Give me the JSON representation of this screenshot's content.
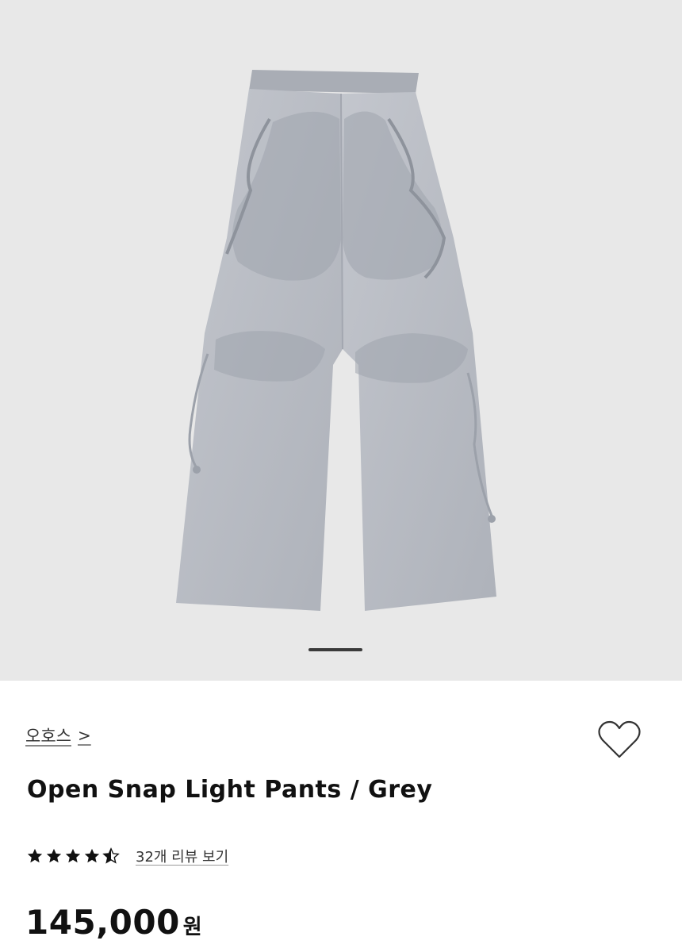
{
  "product": {
    "brand": "오호스",
    "brand_chevron": ">",
    "name": "Open Snap Light Pants / Grey",
    "rating": 4.5,
    "reviews_label": "32개 리뷰 보기",
    "price": "145,000",
    "currency": "원"
  },
  "gallery": {
    "image_subject": "grey-cutout-pants",
    "current_slide": 1
  },
  "icons": {
    "wishlist": "heart-outline-icon",
    "star": "star-icon"
  },
  "colors": {
    "hero_bg": "#e8e8e8",
    "pants": "#b8bcc4",
    "text": "#111111"
  }
}
